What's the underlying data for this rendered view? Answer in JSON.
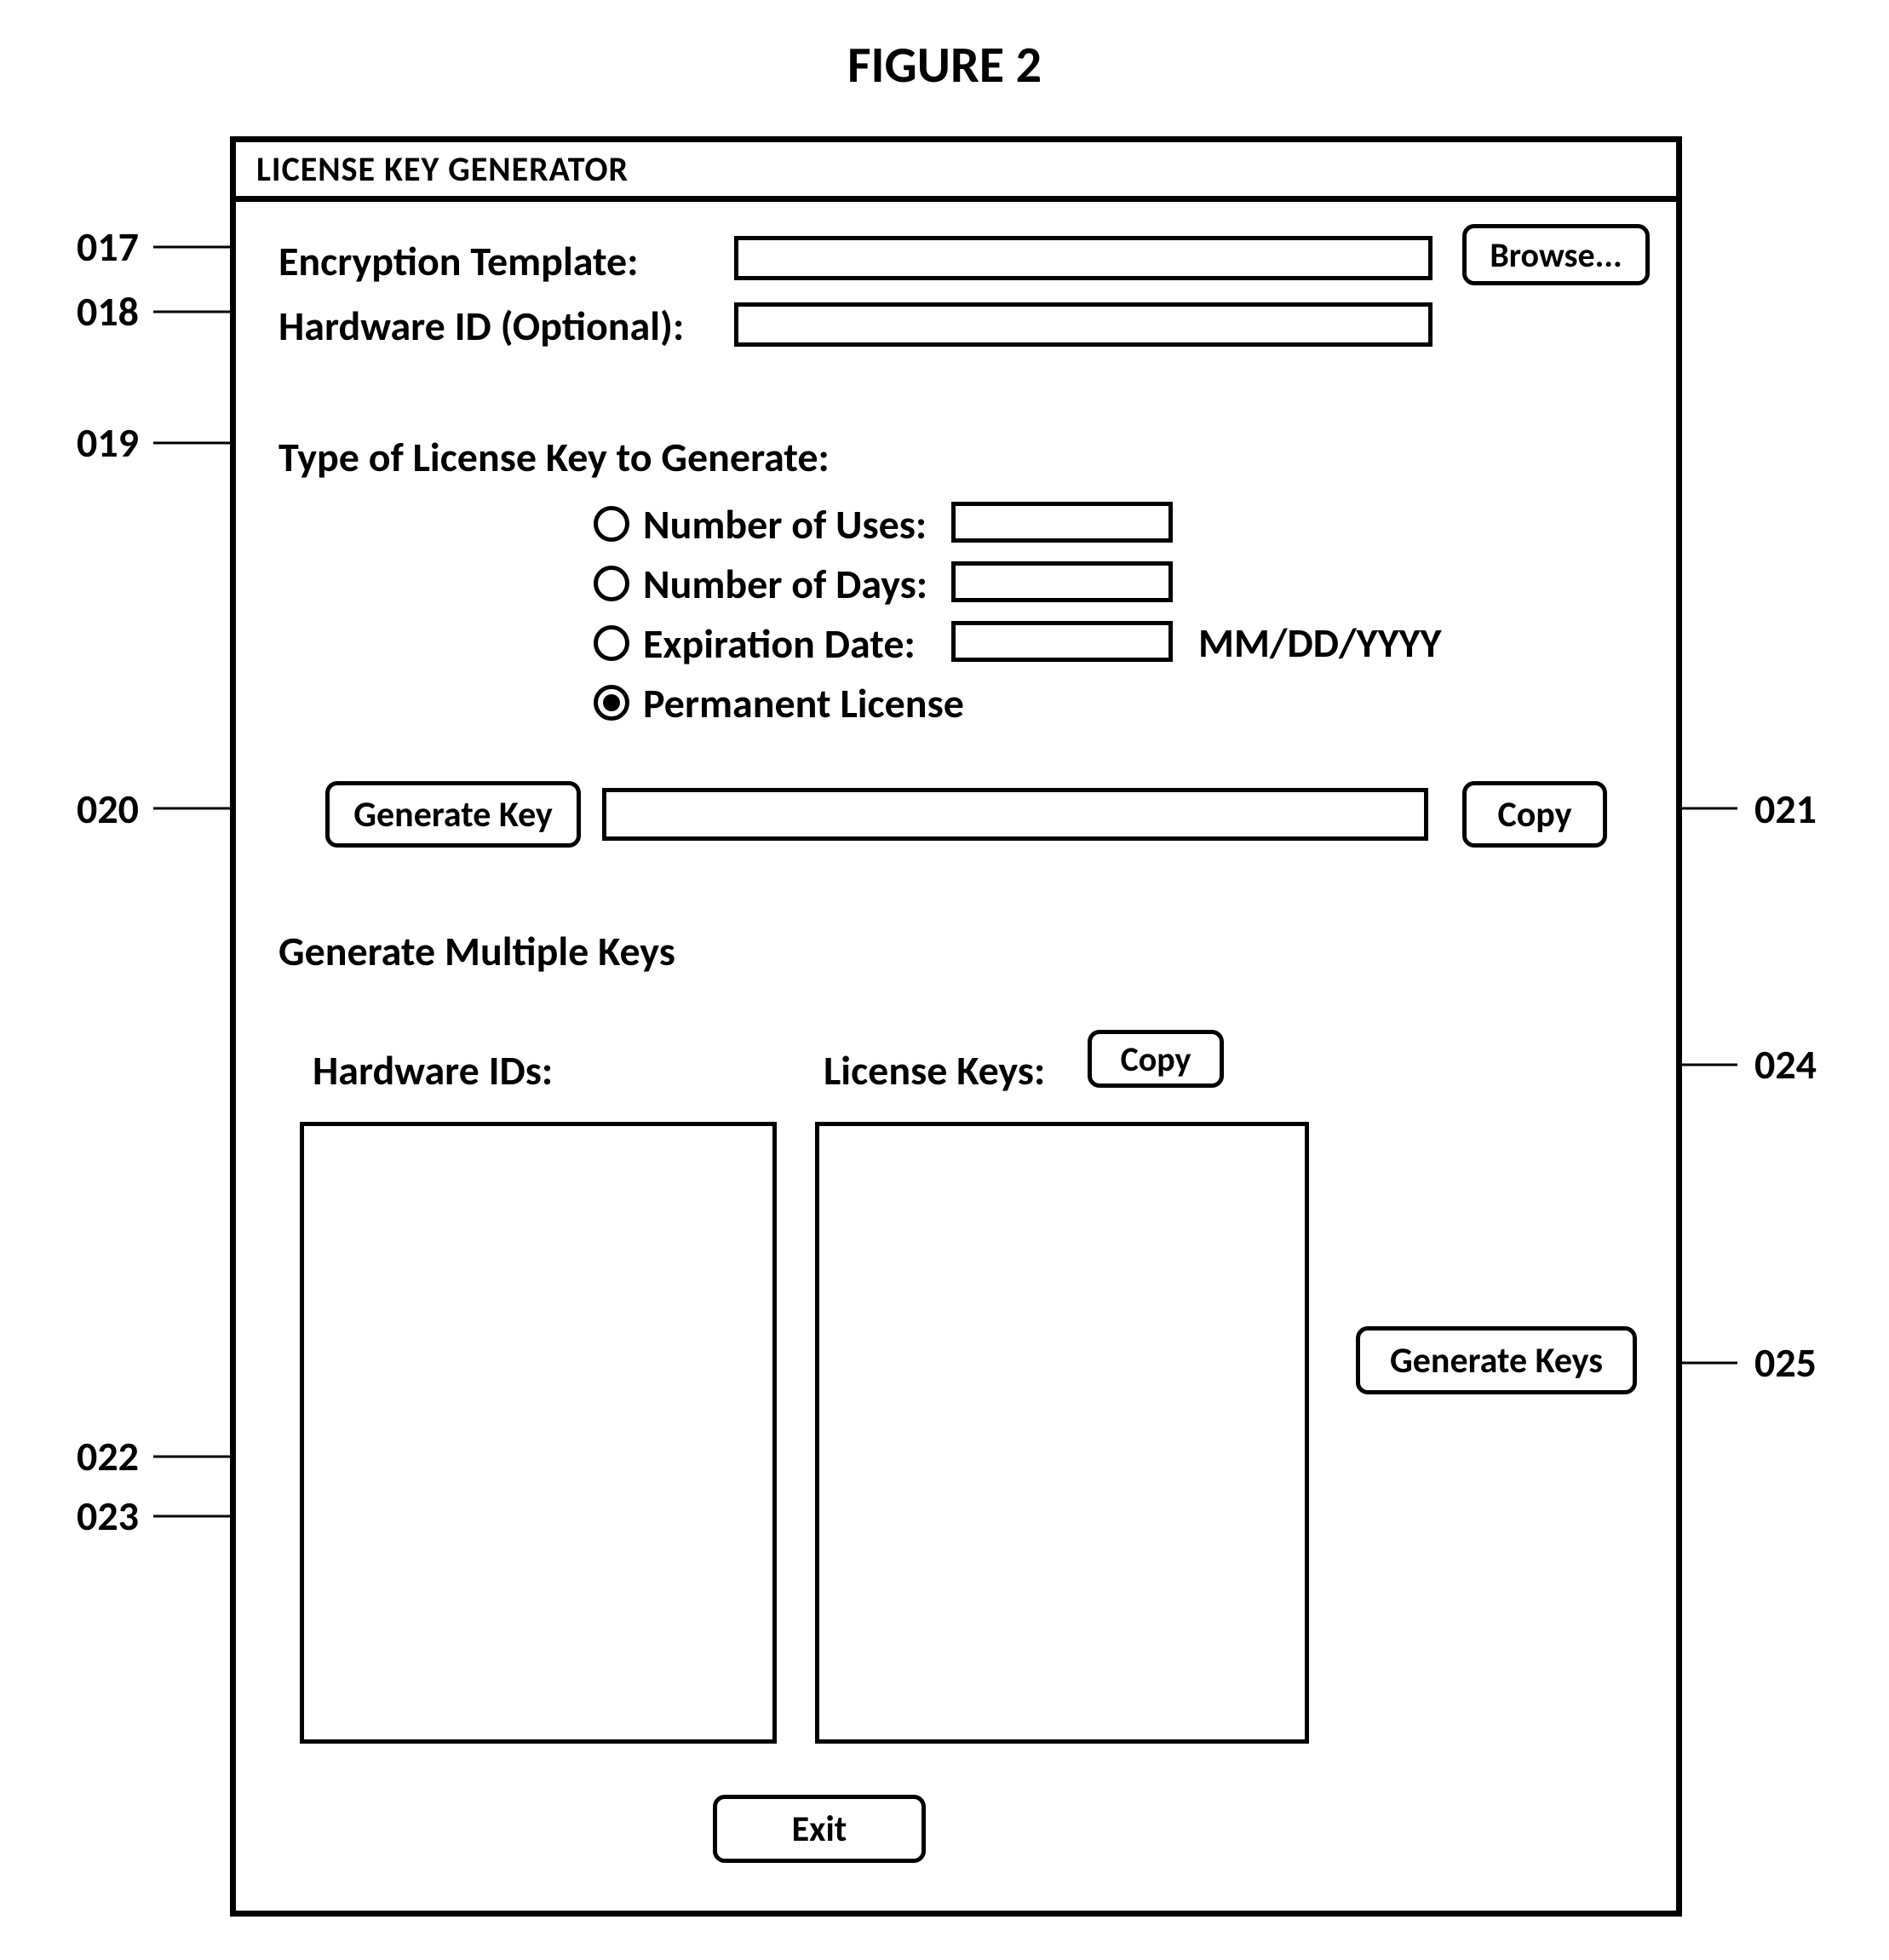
{
  "figure_title": "FIGURE 2",
  "window_title": "LICENSE KEY GENERATOR",
  "row017": {
    "label": "Encryption Template:",
    "value": "",
    "browse": "Browse..."
  },
  "row018": {
    "label": "Hardware ID (Optional):",
    "value": ""
  },
  "section019": {
    "heading": "Type of License Key to Generate:",
    "opt_uses": {
      "label": "Number of Uses:",
      "value": ""
    },
    "opt_days": {
      "label": "Number of Days:",
      "value": ""
    },
    "opt_expiry": {
      "label": "Expiration Date:",
      "value": "",
      "hint": "MM/DD/YYYY"
    },
    "opt_permanent": {
      "label": "Permanent License"
    },
    "selected": "permanent"
  },
  "single": {
    "generate": "Generate Key",
    "value": "",
    "copy": "Copy"
  },
  "multi": {
    "heading": "Generate Multiple Keys",
    "hwids_label": "Hardware IDs:",
    "keys_label": "License Keys:",
    "copy": "Copy",
    "generate": "Generate Keys",
    "hwids_value": "",
    "keys_value": ""
  },
  "exit": "Exit",
  "callouts": {
    "c017": "017",
    "c018": "018",
    "c019": "019",
    "c020": "020",
    "c021": "021",
    "c022": "022",
    "c023": "023",
    "c024": "024",
    "c025": "025"
  }
}
